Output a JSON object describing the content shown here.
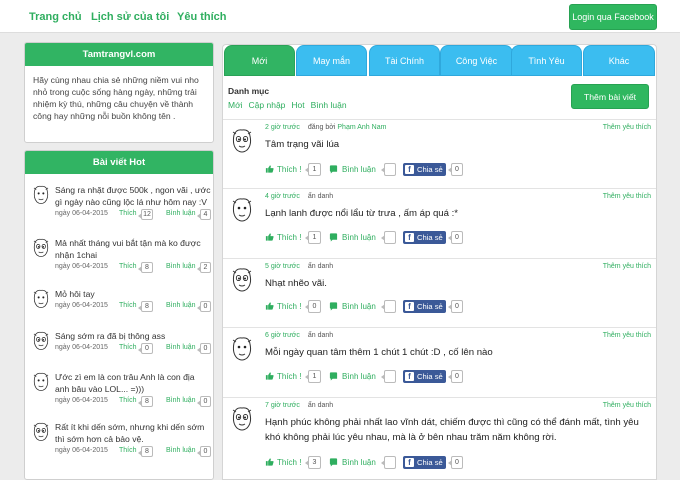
{
  "nav": {
    "home": "Trang chủ",
    "history": "Lịch sử của tôi",
    "favorites": "Yêu thích",
    "login": "Login qua Facebook"
  },
  "site": {
    "name": "Tamtrangvl.com",
    "description": "Hãy cùng nhau chia sẻ những niềm vui nho nhỏ trong cuộc sống hàng ngày, những trải nhiệm kỳ thú, những câu chuyện về thành công hay những nỗi buồn không tên ."
  },
  "hot": {
    "title": "Bài viết Hot",
    "like_label": "Thích",
    "comment_label": "Bình luận",
    "items": [
      {
        "title": "Sáng ra nhặt được 500k , ngon vãi , ước gì ngày nào cũng lộc lá như hôm nay :V",
        "date": "ngày 06-04-2015",
        "likes": "12",
        "comments": "4"
      },
      {
        "title": "Mả nhất tháng vui bắt tận mà ko được nhận 1chai",
        "date": "ngày 06-04-2015",
        "likes": "8",
        "comments": "2"
      },
      {
        "title": "Mỏ hôi tay",
        "date": "ngày 06-04-2015",
        "likes": "8",
        "comments": "0"
      },
      {
        "title": "Sáng sớm ra đã bị thông ass",
        "date": "ngày 06-04-2015",
        "likes": "0",
        "comments": "0"
      },
      {
        "title": "Ước zì em là con trâu Anh là con địa anh bâu vào LOL... =)))",
        "date": "ngày 06-04-2015",
        "likes": "8",
        "comments": "0"
      },
      {
        "title": "Rất ít khi dến sớm, nhưng khi dến sớm thì sớm hơn cả bảo vệ.",
        "date": "ngày 06-04-2015",
        "likes": "8",
        "comments": "0"
      }
    ]
  },
  "tabs": [
    "Mới",
    "May mắn",
    "Tài Chính",
    "Công Việc",
    "Tình Yêu",
    "Khác"
  ],
  "category": {
    "title": "Danh mục",
    "filters": [
      "Mới",
      "Cập nhập",
      "Hot",
      "Bình luận"
    ],
    "add_button": "Thêm bài viết"
  },
  "post_labels": {
    "follow": "Thêm yêu thích",
    "like": "Thích !",
    "comment": "Bình luận",
    "share": "Chia sẻ"
  },
  "posts": [
    {
      "time": "2 giờ trước",
      "author_prefix": "đăng bởi",
      "author": "Phạm Anh Nam",
      "text": "Tâm trạng vãi lúa",
      "likes": "1",
      "comments": "",
      "shares": "0"
    },
    {
      "time": "4 giờ trước",
      "author_prefix": "ẩn danh",
      "author": "",
      "text": "Lạnh lanh được nổi lẩu từ trưa , ấm áp quá :*",
      "likes": "1",
      "comments": "",
      "shares": "0"
    },
    {
      "time": "5 giờ trước",
      "author_prefix": "ẩn danh",
      "author": "",
      "text": "Nhạt nhẽo vãi.",
      "likes": "0",
      "comments": "",
      "shares": "0"
    },
    {
      "time": "6 giờ trước",
      "author_prefix": "ẩn danh",
      "author": "",
      "text": "Mỗi ngày quan tâm thêm 1 chút 1 chút :D , cố lên nào",
      "likes": "1",
      "comments": "",
      "shares": "0"
    },
    {
      "time": "7 giờ trước",
      "author_prefix": "ẩn danh",
      "author": "",
      "text": "Hạnh phúc không phải nhất lao vĩnh dát, chiếm được thì cũng có thể đánh mất, tình yêu khó không phải lúc yêu nhau, mà là ở bên nhau trăm năm không rời.",
      "likes": "3",
      "comments": "",
      "shares": "0"
    }
  ],
  "colors": {
    "green": "#31b463",
    "blue_tab": "#3bbdf0",
    "facebook": "#3b5998"
  }
}
